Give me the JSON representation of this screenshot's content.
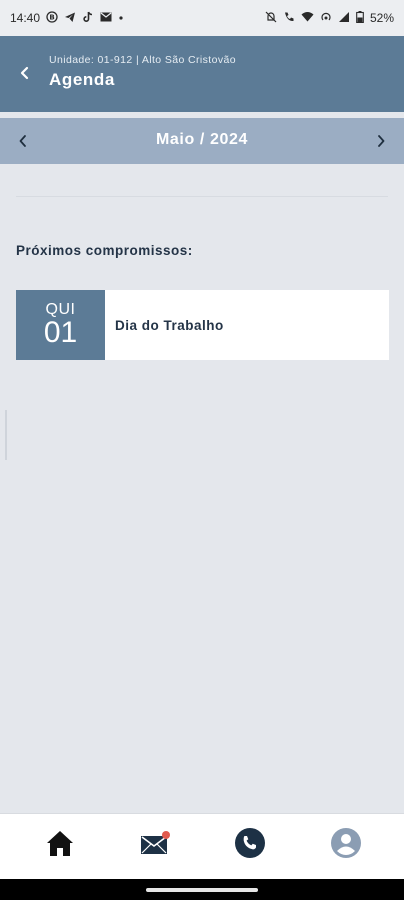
{
  "status_bar": {
    "time": "14:40",
    "battery": "52%",
    "left_icons": [
      "b-circle-icon",
      "telegram-icon",
      "tiktok-icon",
      "mail-icon",
      "dot-icon"
    ],
    "right_icons": [
      "mute-icon",
      "call-icon",
      "wifi-icon",
      "signal-icon",
      "battery-icon"
    ]
  },
  "header": {
    "subtitle": "Unidade: 01-912 | Alto São Cristovão",
    "title": "Agenda"
  },
  "month_nav": {
    "label": "Maio / 2024"
  },
  "upcoming": {
    "title": "Próximos compromissos:",
    "events": [
      {
        "weekday": "QUI",
        "day": "01",
        "title": "Dia do Trabalho"
      }
    ]
  },
  "bottom_nav": {
    "items": [
      "home-icon",
      "mail-icon",
      "phone-icon",
      "profile-icon"
    ],
    "colors": {
      "active": "#111111",
      "mail_badge": "#e05a4e",
      "phone_bg": "#1d3145",
      "profile_bg": "#8b9db3"
    }
  },
  "colors": {
    "header_bg": "#5c7b96",
    "month_bar_bg": "#9badc3",
    "page_bg": "#e4e7ec"
  }
}
